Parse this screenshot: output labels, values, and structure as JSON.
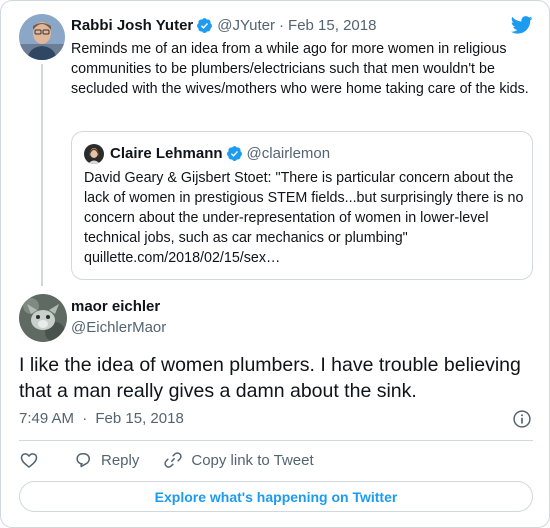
{
  "parent_tweet": {
    "name": "Rabbi Josh Yuter",
    "handle": "@JYuter",
    "separator": "·",
    "date": "Feb 15, 2018",
    "text": "Reminds me of an idea from a while ago for more women in religious communities to be plumbers/electricians such that men wouldn't be secluded with the wives/mothers who were home taking care of the kids."
  },
  "quoted_tweet": {
    "name": "Claire Lehmann",
    "handle": "@clairlemon",
    "text": "David Geary & Gijsbert Stoet: \"There is particular concern about the lack of women in prestigious STEM fields...but surprisingly there is no concern about the under-representation of women in lower-level technical jobs, such as car mechanics or plumbing\"",
    "link": "quillette.com/2018/02/15/sex…"
  },
  "main_tweet": {
    "name": "maor eichler",
    "handle": "@EichlerMaor",
    "text": "I like the idea of women plumbers. I have trouble believing that a man really gives a damn about the sink.",
    "time": "7:49 AM",
    "separator": "·",
    "date": "Feb 15, 2018"
  },
  "actions": {
    "reply_label": "Reply",
    "copy_link_label": "Copy link to Tweet"
  },
  "explore_label": "Explore what's happening on Twitter",
  "colors": {
    "accent": "#1d9bf0",
    "text": "#0f1419",
    "muted": "#536471",
    "border": "#cfd9de"
  },
  "icons": [
    "twitter-bird-icon",
    "verified-badge-icon",
    "heart-icon",
    "reply-icon",
    "link-icon",
    "info-icon"
  ]
}
